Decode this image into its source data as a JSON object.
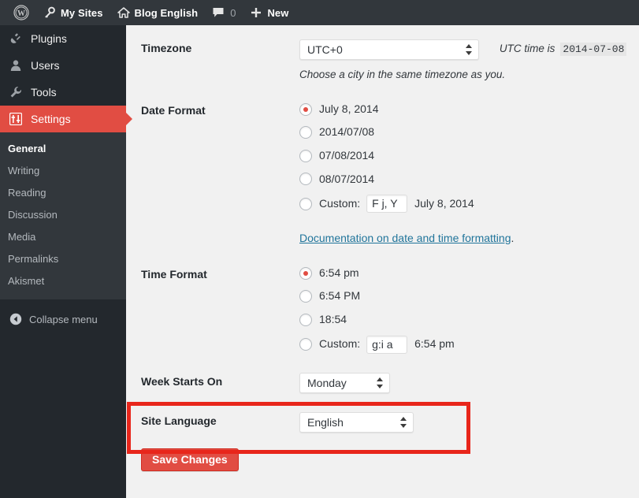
{
  "adminbar": {
    "items": [
      {
        "name": "wordpress-logo",
        "icon": "wordpress-logo-icon",
        "label": ""
      },
      {
        "name": "my-sites",
        "icon": "key-icon",
        "label": "My Sites"
      },
      {
        "name": "site-name",
        "icon": "home-icon",
        "label": "Blog English"
      },
      {
        "name": "comments",
        "icon": "comment-bubble-icon",
        "label": "",
        "count": "0"
      },
      {
        "name": "new-content",
        "icon": "plus-icon",
        "label": "New"
      }
    ]
  },
  "sidebar": {
    "top_items": [
      {
        "label": "Plugins",
        "icon": "plug-icon",
        "current": false
      },
      {
        "label": "Users",
        "icon": "user-icon",
        "current": false
      },
      {
        "label": "Tools",
        "icon": "wrench-icon",
        "current": false
      },
      {
        "label": "Settings",
        "icon": "sliders-icon",
        "current": true
      }
    ],
    "submenu": [
      {
        "label": "General",
        "current": true
      },
      {
        "label": "Writing",
        "current": false
      },
      {
        "label": "Reading",
        "current": false
      },
      {
        "label": "Discussion",
        "current": false
      },
      {
        "label": "Media",
        "current": false
      },
      {
        "label": "Permalinks",
        "current": false
      },
      {
        "label": "Akismet",
        "current": false
      }
    ],
    "collapse": {
      "label": "Collapse menu",
      "icon": "arrow-left-circle-icon"
    }
  },
  "settings": {
    "timezone": {
      "label": "Timezone",
      "value": "UTC+0",
      "utc_note": "UTC time is",
      "utc_value": "2014-07-08",
      "description": "Choose a city in the same timezone as you."
    },
    "date_format": {
      "label": "Date Format",
      "options": [
        {
          "label": "July 8, 2014",
          "checked": true
        },
        {
          "label": "2014/07/08",
          "checked": false
        },
        {
          "label": "07/08/2014",
          "checked": false
        },
        {
          "label": "08/07/2014",
          "checked": false
        }
      ],
      "custom_label": "Custom:",
      "custom_value": "F j, Y",
      "custom_preview": "July 8, 2014",
      "doc_link": "Documentation on date and time formatting",
      "doc_suffix": "."
    },
    "time_format": {
      "label": "Time Format",
      "options": [
        {
          "label": "6:54 pm",
          "checked": true
        },
        {
          "label": "6:54 PM",
          "checked": false
        },
        {
          "label": "18:54",
          "checked": false
        }
      ],
      "custom_label": "Custom:",
      "custom_value": "g:i a",
      "custom_preview": "6:54 pm"
    },
    "week_starts_on": {
      "label": "Week Starts On",
      "value": "Monday"
    },
    "site_language": {
      "label": "Site Language",
      "value": "English"
    },
    "submit": {
      "label": "Save Changes"
    }
  },
  "colors": {
    "accent_red": "#e14d43",
    "highlight_red": "#e8261b",
    "link_blue": "#21759b",
    "sidebar_dark": "#23282d",
    "submenu_dark": "#32373c",
    "content_bg": "#f1f1f1"
  }
}
